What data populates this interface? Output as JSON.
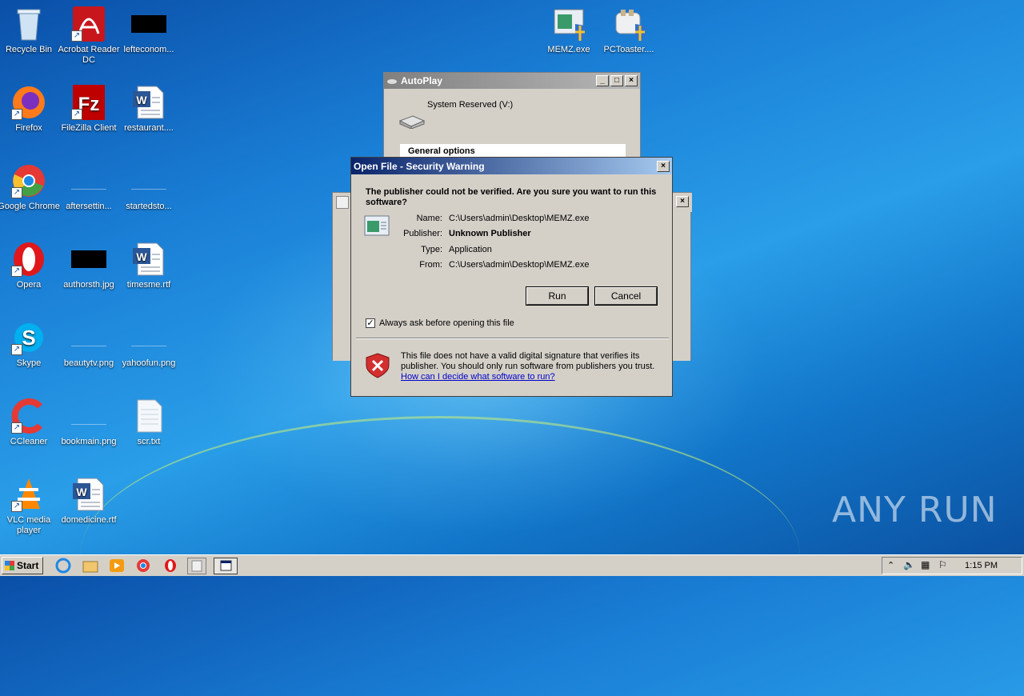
{
  "desktop": {
    "icons": [
      {
        "label": "Recycle Bin"
      },
      {
        "label": "Acrobat Reader DC"
      },
      {
        "label": "lefteconom..."
      },
      {
        "label": "Firefox"
      },
      {
        "label": "FileZilla Client"
      },
      {
        "label": "restaurant...."
      },
      {
        "label": "Google Chrome"
      },
      {
        "label": "aftersettin..."
      },
      {
        "label": "startedsto..."
      },
      {
        "label": "Opera"
      },
      {
        "label": "authorsth.jpg"
      },
      {
        "label": "timesme.rtf"
      },
      {
        "label": "Skype"
      },
      {
        "label": "beautytv.png"
      },
      {
        "label": "yahoofun.png"
      },
      {
        "label": "CCleaner"
      },
      {
        "label": "bookmain.png"
      },
      {
        "label": "scr.txt"
      },
      {
        "label": "VLC media player"
      },
      {
        "label": "domedicine.rtf"
      },
      {
        "label": "MEMZ.exe"
      },
      {
        "label": "PCToaster...."
      }
    ]
  },
  "autoplay": {
    "title": "AutoPlay",
    "drive": "System Reserved (V:)",
    "section": "General options"
  },
  "dialog": {
    "title": "Open File - Security Warning",
    "question": "The publisher could not be verified.  Are you sure you want to run this software?",
    "fields": {
      "name_label": "Name:",
      "name": "C:\\Users\\admin\\Desktop\\MEMZ.exe",
      "publisher_label": "Publisher:",
      "publisher": "Unknown Publisher",
      "type_label": "Type:",
      "type": "Application",
      "from_label": "From:",
      "from": "C:\\Users\\admin\\Desktop\\MEMZ.exe"
    },
    "run": "Run",
    "cancel": "Cancel",
    "checkbox": "Always ask before opening this file",
    "checkbox_checked": true,
    "warning": "This file does not have a valid digital signature that verifies its publisher.  You should only run software from publishers you trust.",
    "link": "How can I decide what software to run?"
  },
  "taskbar": {
    "start": "Start",
    "clock": "1:15 PM"
  },
  "watermark": "ANY RUN"
}
